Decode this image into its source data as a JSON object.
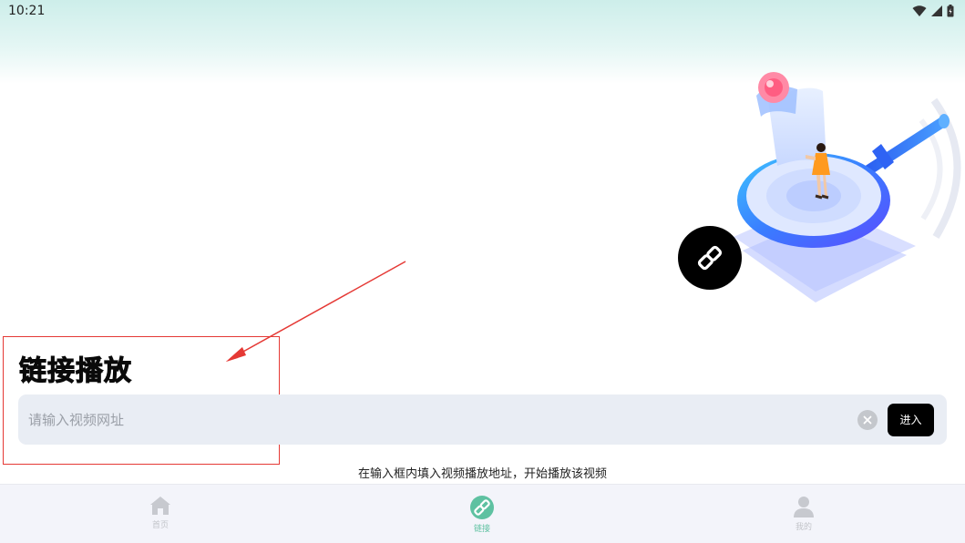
{
  "status_bar": {
    "time": "10:21",
    "icons": [
      "wifi-icon",
      "cell-signal-icon",
      "battery-icon"
    ]
  },
  "page": {
    "heading": "链接播放",
    "input_placeholder": "请输入视频网址",
    "input_value": "",
    "enter_button": "进入",
    "hint": "在输入框内填入视频播放地址，开始播放该视频"
  },
  "bottom_nav": {
    "items": [
      {
        "label": "首页",
        "icon": "home-icon",
        "active": false
      },
      {
        "label": "链接",
        "icon": "link-icon",
        "active": true
      },
      {
        "label": "我的",
        "icon": "user-icon",
        "active": false
      }
    ]
  },
  "colors": {
    "accent": "#5ec1a1",
    "annotation": "#e53935",
    "search_bg": "#e9edf4",
    "nav_bg": "#f3f4fa",
    "button_bg": "#000000"
  }
}
